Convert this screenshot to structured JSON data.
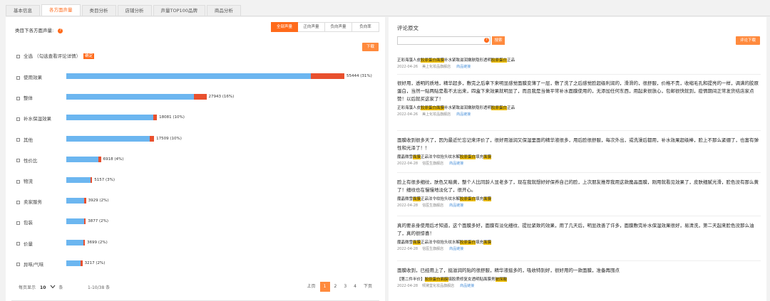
{
  "tabs": [
    "基本信息",
    "各方面声量",
    "类目分析",
    "店铺分析",
    "声量TOP100品牌",
    "商品分析"
  ],
  "active_tab": 1,
  "left": {
    "title": "类目下各方面声量:",
    "q_icon": "?",
    "segments": [
      "全部声量",
      "正向声量",
      "负向声量",
      "负向率"
    ],
    "download": "下载",
    "select_all": "全选 （勾选查看评论详情）",
    "confirm": "确定",
    "aspects": [
      {
        "label": "使用效果",
        "value": "55444 (31%)",
        "total": 55444,
        "neg_frac": 0.12
      },
      {
        "label": "整体",
        "value": "27943 (16%)",
        "total": 27943,
        "neg_frac": 0.09
      },
      {
        "label": "补水保湿效果",
        "value": "18081 (10%)",
        "total": 18081,
        "neg_frac": 0.04
      },
      {
        "label": "其他",
        "value": "17509 (10%)",
        "total": 17509,
        "neg_frac": 0.05
      },
      {
        "label": "性价比",
        "value": "6918 (4%)",
        "total": 6918,
        "neg_frac": 0.08
      },
      {
        "label": "物流",
        "value": "5157 (3%)",
        "total": 5157,
        "neg_frac": 0.07
      },
      {
        "label": "卖家服务",
        "value": "3929 (2%)",
        "total": 3929,
        "neg_frac": 0.09
      },
      {
        "label": "包装",
        "value": "3877 (2%)",
        "total": 3877,
        "neg_frac": 0.1
      },
      {
        "label": "价量",
        "value": "3699 (2%)",
        "total": 3699,
        "neg_frac": 0.08
      },
      {
        "label": "异味/气味",
        "value": "3217 (2%)",
        "total": 3217,
        "neg_frac": 0.1
      }
    ],
    "pager": {
      "per_page_label": "每页显示",
      "per_page": "10",
      "unit": "条",
      "count": "1-10/38 条",
      "prev": "上页",
      "pages": [
        "1",
        "2",
        "3",
        "4"
      ],
      "current": "1",
      "next": "下页"
    }
  },
  "right": {
    "title": "评论原文",
    "search_q": "?",
    "search_btn": "搜索",
    "download": "评论下载",
    "comments": [
      {
        "text": "",
        "product_pre": "正彩海藻人皮",
        "product_hl1": "胶原蛋白面膜",
        "product_mid": "补水紧致滋润嫩肤隐形透明",
        "product_hl2": "胶原蛋白",
        "product_post": "正品",
        "date": "2022-04-26",
        "shop": "美上化妆品旗舰店",
        "link": "商品链接"
      },
      {
        "text": "很好用，透明的质地，精华超多，敷完之后拿下来明显感觉面膜变薄了一层，敷了洗了之后感觉脸超级利润的，滑滑的，很舒服，价格不贵，收缩毛孔和提亮的一样，调满的胶原蛋白，当然一贴两贴是看不太出来，四盒下来效果就明显了，而且我是当做平常补水面膜使用的，无添加任何东西，用起来很放心，包邮很快就到，疫情期间正常发货结店家点赞！以后就买这家了！",
        "product_pre": "正彩海藻人皮",
        "product_hl1": "胶原蛋白面膜",
        "product_mid": "补水紧致滋润嫩肤隐形透明",
        "product_hl2": "胶原蛋白",
        "product_post": "正品",
        "date": "2022-04-26",
        "shop": "美上化妆品旗舰店",
        "link": "商品链接"
      },
      {
        "text": "面膜收到很多天了，因为最近忙忘记来评价了，很好用滋润又保湿里面的精华液很多，用后脸很舒服，每次外出，或洗澡后都用，补水效果超级棒，脸上不那么紧绷了，也富有弹性和光泽了！！",
        "product_pre": "魔晶微雪",
        "product_hl1": "面膜",
        "product_mid": "正品法令纹抬头纹水解",
        "product_hl2": "胶原蛋白",
        "product_mid2": "填充",
        "product_hl3": "面膜",
        "product_post": "",
        "date": "2022-04-28",
        "shop": "信医生旗舰店",
        "link": "商品链接"
      },
      {
        "text": "脸上有很多细纹，肤色又暗黄，整个人比同龄人显老多了，现在我就想好好保养自己的脸，上次朋友推荐我用这款魔晶面膜，刚用就看见效果了，皮肤细腻光滑，脸色没有那么黄了！细纹也在慢慢地淡化了，很开心。",
        "product_pre": "魔晶微雪",
        "product_hl1": "面膜",
        "product_mid": "正品法令纹抬头纹水解",
        "product_hl2": "胶原蛋白",
        "product_mid2": "填充",
        "product_hl3": "面膜",
        "product_post": "",
        "date": "2022-04-28",
        "shop": "信医生旗舰店",
        "link": "商品链接"
      },
      {
        "text": "真的要亲身使用后才知道，这个面膜多好，面膜有淡化细纹、提拉紧致的效果，用了几天后，明显改善了许多，面膜敷完补水保湿效果很好，易清洗，第二天起来脸色没那么油了，真的很惊喜！",
        "product_pre": "魔晶微雪",
        "product_hl1": "面膜",
        "product_mid": "正品法令纹抬头纹水解",
        "product_hl2": "胶原蛋白",
        "product_mid2": "填充",
        "product_hl3": "面膜",
        "product_post": "",
        "date": "2022-04-28",
        "shop": "信医生旗舰店",
        "link": "商品链接"
      },
      {
        "text": "面膜收到，已经用上了，挺滋润的贴的很舒服，精华液挺多的，吸收特别好，很好用的一款面膜，准备再囤点",
        "product_pre": "【第二件半价】",
        "product_hl1": "胶原蛋白面膜",
        "product_mid": "填胶质修复女透明贴面膜男",
        "product_hl2": "玻尿酸",
        "product_post": "",
        "date": "2022-04-28",
        "shop": "倾黛堂化妆品旗舰店",
        "link": "商品链接"
      }
    ]
  }
}
